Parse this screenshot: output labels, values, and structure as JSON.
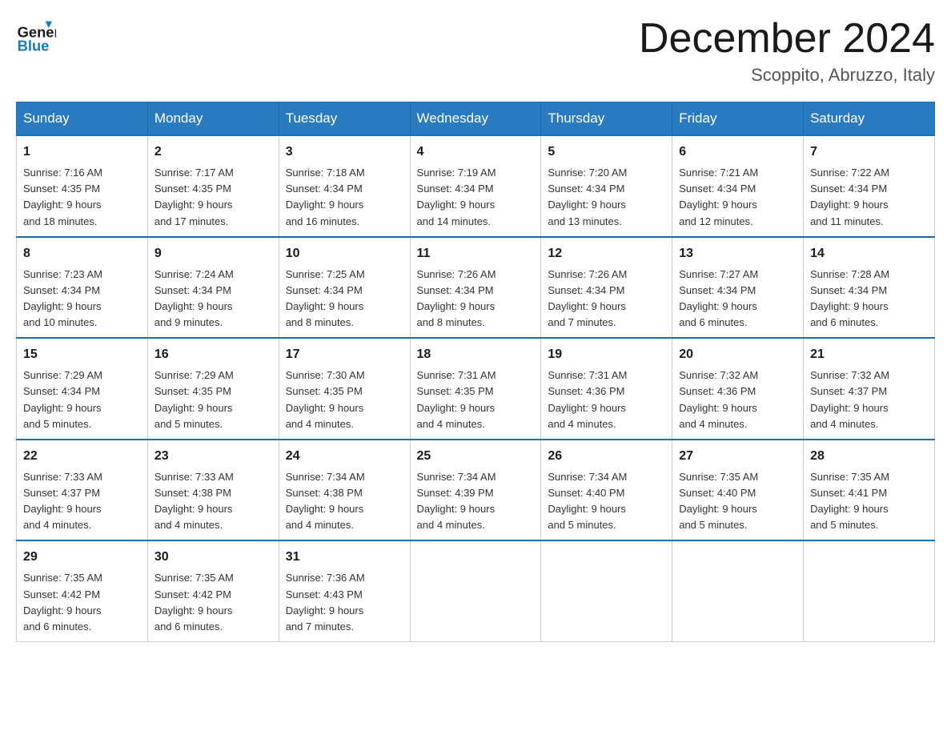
{
  "header": {
    "logo": {
      "general_text": "General",
      "blue_text": "Blue"
    },
    "month_title": "December 2024",
    "location": "Scoppito, Abruzzo, Italy"
  },
  "weekdays": [
    "Sunday",
    "Monday",
    "Tuesday",
    "Wednesday",
    "Thursday",
    "Friday",
    "Saturday"
  ],
  "weeks": [
    [
      {
        "day": "1",
        "sunrise": "Sunrise: 7:16 AM",
        "sunset": "Sunset: 4:35 PM",
        "daylight": "Daylight: 9 hours and 18 minutes."
      },
      {
        "day": "2",
        "sunrise": "Sunrise: 7:17 AM",
        "sunset": "Sunset: 4:35 PM",
        "daylight": "Daylight: 9 hours and 17 minutes."
      },
      {
        "day": "3",
        "sunrise": "Sunrise: 7:18 AM",
        "sunset": "Sunset: 4:34 PM",
        "daylight": "Daylight: 9 hours and 16 minutes."
      },
      {
        "day": "4",
        "sunrise": "Sunrise: 7:19 AM",
        "sunset": "Sunset: 4:34 PM",
        "daylight": "Daylight: 9 hours and 14 minutes."
      },
      {
        "day": "5",
        "sunrise": "Sunrise: 7:20 AM",
        "sunset": "Sunset: 4:34 PM",
        "daylight": "Daylight: 9 hours and 13 minutes."
      },
      {
        "day": "6",
        "sunrise": "Sunrise: 7:21 AM",
        "sunset": "Sunset: 4:34 PM",
        "daylight": "Daylight: 9 hours and 12 minutes."
      },
      {
        "day": "7",
        "sunrise": "Sunrise: 7:22 AM",
        "sunset": "Sunset: 4:34 PM",
        "daylight": "Daylight: 9 hours and 11 minutes."
      }
    ],
    [
      {
        "day": "8",
        "sunrise": "Sunrise: 7:23 AM",
        "sunset": "Sunset: 4:34 PM",
        "daylight": "Daylight: 9 hours and 10 minutes."
      },
      {
        "day": "9",
        "sunrise": "Sunrise: 7:24 AM",
        "sunset": "Sunset: 4:34 PM",
        "daylight": "Daylight: 9 hours and 9 minutes."
      },
      {
        "day": "10",
        "sunrise": "Sunrise: 7:25 AM",
        "sunset": "Sunset: 4:34 PM",
        "daylight": "Daylight: 9 hours and 8 minutes."
      },
      {
        "day": "11",
        "sunrise": "Sunrise: 7:26 AM",
        "sunset": "Sunset: 4:34 PM",
        "daylight": "Daylight: 9 hours and 8 minutes."
      },
      {
        "day": "12",
        "sunrise": "Sunrise: 7:26 AM",
        "sunset": "Sunset: 4:34 PM",
        "daylight": "Daylight: 9 hours and 7 minutes."
      },
      {
        "day": "13",
        "sunrise": "Sunrise: 7:27 AM",
        "sunset": "Sunset: 4:34 PM",
        "daylight": "Daylight: 9 hours and 6 minutes."
      },
      {
        "day": "14",
        "sunrise": "Sunrise: 7:28 AM",
        "sunset": "Sunset: 4:34 PM",
        "daylight": "Daylight: 9 hours and 6 minutes."
      }
    ],
    [
      {
        "day": "15",
        "sunrise": "Sunrise: 7:29 AM",
        "sunset": "Sunset: 4:34 PM",
        "daylight": "Daylight: 9 hours and 5 minutes."
      },
      {
        "day": "16",
        "sunrise": "Sunrise: 7:29 AM",
        "sunset": "Sunset: 4:35 PM",
        "daylight": "Daylight: 9 hours and 5 minutes."
      },
      {
        "day": "17",
        "sunrise": "Sunrise: 7:30 AM",
        "sunset": "Sunset: 4:35 PM",
        "daylight": "Daylight: 9 hours and 4 minutes."
      },
      {
        "day": "18",
        "sunrise": "Sunrise: 7:31 AM",
        "sunset": "Sunset: 4:35 PM",
        "daylight": "Daylight: 9 hours and 4 minutes."
      },
      {
        "day": "19",
        "sunrise": "Sunrise: 7:31 AM",
        "sunset": "Sunset: 4:36 PM",
        "daylight": "Daylight: 9 hours and 4 minutes."
      },
      {
        "day": "20",
        "sunrise": "Sunrise: 7:32 AM",
        "sunset": "Sunset: 4:36 PM",
        "daylight": "Daylight: 9 hours and 4 minutes."
      },
      {
        "day": "21",
        "sunrise": "Sunrise: 7:32 AM",
        "sunset": "Sunset: 4:37 PM",
        "daylight": "Daylight: 9 hours and 4 minutes."
      }
    ],
    [
      {
        "day": "22",
        "sunrise": "Sunrise: 7:33 AM",
        "sunset": "Sunset: 4:37 PM",
        "daylight": "Daylight: 9 hours and 4 minutes."
      },
      {
        "day": "23",
        "sunrise": "Sunrise: 7:33 AM",
        "sunset": "Sunset: 4:38 PM",
        "daylight": "Daylight: 9 hours and 4 minutes."
      },
      {
        "day": "24",
        "sunrise": "Sunrise: 7:34 AM",
        "sunset": "Sunset: 4:38 PM",
        "daylight": "Daylight: 9 hours and 4 minutes."
      },
      {
        "day": "25",
        "sunrise": "Sunrise: 7:34 AM",
        "sunset": "Sunset: 4:39 PM",
        "daylight": "Daylight: 9 hours and 4 minutes."
      },
      {
        "day": "26",
        "sunrise": "Sunrise: 7:34 AM",
        "sunset": "Sunset: 4:40 PM",
        "daylight": "Daylight: 9 hours and 5 minutes."
      },
      {
        "day": "27",
        "sunrise": "Sunrise: 7:35 AM",
        "sunset": "Sunset: 4:40 PM",
        "daylight": "Daylight: 9 hours and 5 minutes."
      },
      {
        "day": "28",
        "sunrise": "Sunrise: 7:35 AM",
        "sunset": "Sunset: 4:41 PM",
        "daylight": "Daylight: 9 hours and 5 minutes."
      }
    ],
    [
      {
        "day": "29",
        "sunrise": "Sunrise: 7:35 AM",
        "sunset": "Sunset: 4:42 PM",
        "daylight": "Daylight: 9 hours and 6 minutes."
      },
      {
        "day": "30",
        "sunrise": "Sunrise: 7:35 AM",
        "sunset": "Sunset: 4:42 PM",
        "daylight": "Daylight: 9 hours and 6 minutes."
      },
      {
        "day": "31",
        "sunrise": "Sunrise: 7:36 AM",
        "sunset": "Sunset: 4:43 PM",
        "daylight": "Daylight: 9 hours and 7 minutes."
      },
      null,
      null,
      null,
      null
    ]
  ]
}
